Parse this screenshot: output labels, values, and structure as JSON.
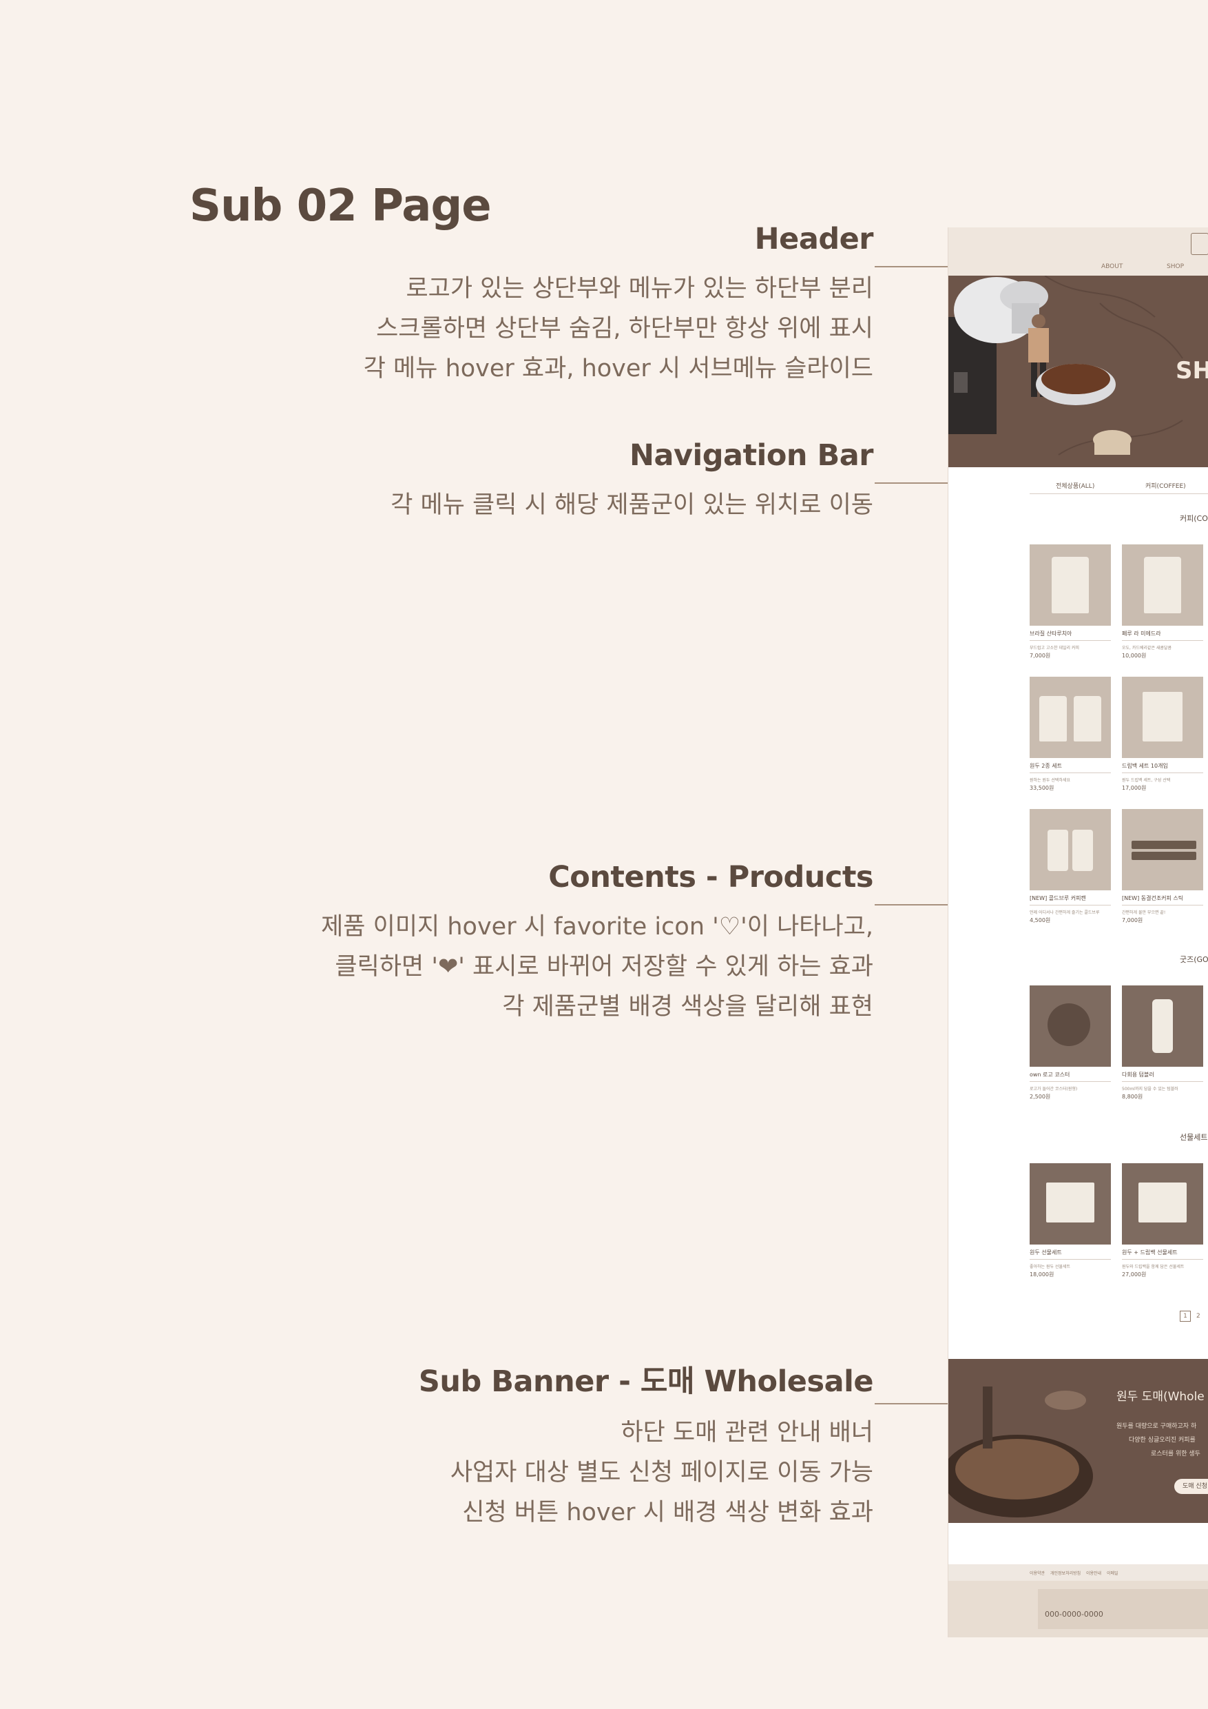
{
  "page_title": "Sub 02 Page",
  "annotations": {
    "header": {
      "title": "Header",
      "lines": [
        "로고가 있는 상단부와 메뉴가 있는 하단부 분리",
        "스크롤하면 상단부 숨김, 하단부만 항상 위에 표시",
        "각 메뉴 hover 효과, hover 시 서브메뉴 슬라이드"
      ]
    },
    "navigation": {
      "title": "Navigation Bar",
      "lines": [
        "각 메뉴 클릭 시 해당 제품군이 있는 위치로 이동"
      ]
    },
    "products": {
      "title": "Contents - Products",
      "lines": [
        "제품 이미지 hover 시 favorite icon '♡'이 나타나고,",
        "클릭하면 '❤' 표시로 바뀌어 저장할 수 있게 하는 효과",
        "각 제품군별 배경 색상을 달리해 표현"
      ]
    },
    "wholesale": {
      "title": "Sub Banner - 도매 Wholesale",
      "lines": [
        "하단 도매 관련 안내 배너",
        "사업자 대상 별도 신청 페이지로 이동 가능",
        "신청 버튼 hover 시 배경 색상 변화 효과"
      ]
    }
  },
  "mockup": {
    "nav": [
      "ABOUT",
      "SHOP"
    ],
    "hero_text": "SH",
    "tabs": [
      "전체상품(ALL)",
      "커피(COFFEE)"
    ],
    "sections": {
      "coffee": "커피(CO",
      "goods": "굿즈(GO",
      "gift": "선물세트"
    },
    "coffee_products": [
      {
        "name": "브라질 산타루치아",
        "desc": "부드럽고 고소한 데일리 커피",
        "price": "7,000원"
      },
      {
        "name": "페루 라 미에드라",
        "desc": "오도, 카드베리같은 새콤달콤",
        "price": "10,000원"
      },
      {
        "name": "원두 2종 세트",
        "desc": "원하는 원두 선택하세요",
        "price": "33,500원"
      },
      {
        "name": "드립백 세트 10개입",
        "desc": "원두 드립백 세트, 구성 선택",
        "price": "17,000원"
      },
      {
        "name": "[NEW] 콜드브루 커피캔",
        "desc": "언제 어디서나 간편하게 즐기는 콜드브루",
        "price": "4,500원"
      },
      {
        "name": "[NEW] 동결건조커피 스틱",
        "desc": "간편하게 물만 부으면 끝!",
        "price": "7,000원"
      }
    ],
    "goods_products": [
      {
        "name": "own 로고 코스터",
        "desc": "로고가 들어간 코스터(원형)",
        "price": "2,500원"
      },
      {
        "name": "다회용 텀블러",
        "desc": "500ml까지 담을 수 있는 텀블러",
        "price": "8,800원"
      }
    ],
    "gift_products": [
      {
        "name": "원두 선물세트",
        "desc": "좋아하는 원두 선물세트",
        "price": "18,000원"
      },
      {
        "name": "원두 + 드립백 선물세트",
        "desc": "원두와 드립백을 함께 담은 선물세트",
        "price": "27,000원"
      }
    ],
    "pager": [
      "1",
      "2"
    ],
    "wholesale": {
      "title": "원두 도매(Whole",
      "lines": [
        "원두를 대량으로 구매하고자 하",
        "다양한 싱글오리진 커피를",
        "로스터를 위한 생두"
      ],
      "button": "도매 신청"
    },
    "footer": {
      "nav": [
        "이용약관",
        "개인정보처리방침",
        "이용안내",
        "이메일"
      ],
      "phone": "000-0000-0000"
    }
  }
}
